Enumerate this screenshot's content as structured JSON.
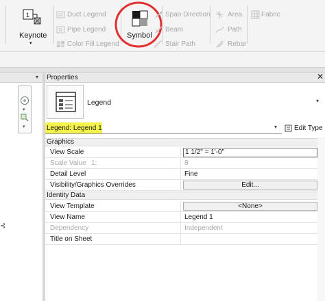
{
  "ribbon": {
    "keynote_label": "Keynote",
    "symbol_label": "Symbol",
    "items": [
      {
        "label": "Duct Legend",
        "icon": "duct-legend-icon"
      },
      {
        "label": "Pipe Legend",
        "icon": "pipe-legend-icon"
      },
      {
        "label": "Color Fill Legend",
        "icon": "color-fill-legend-icon"
      },
      {
        "label": "Span Direction",
        "icon": "span-direction-icon"
      },
      {
        "label": "Beam",
        "icon": "beam-icon"
      },
      {
        "label": "Stair Path",
        "icon": "stair-path-icon"
      },
      {
        "label": "Area",
        "icon": "area-icon"
      },
      {
        "label": "Path",
        "icon": "path-icon"
      },
      {
        "label": "Rebar",
        "icon": "rebar-icon"
      },
      {
        "label": "Fabric",
        "icon": "fabric-icon"
      }
    ],
    "highlight_color": "#e03030"
  },
  "properties": {
    "title": "Properties",
    "type_name": "Legend",
    "instance_selector": "Legend: Legend 1",
    "edit_type_label": "Edit Type",
    "highlight_color": "#f3f34c",
    "sections": {
      "graphics": "Graphics",
      "identity": "Identity Data"
    },
    "rows": {
      "view_scale": {
        "label": "View Scale",
        "value": "1 1/2\" = 1'-0\""
      },
      "scale_value": {
        "label": "Scale Value",
        "mid": "1:",
        "value": "8"
      },
      "detail_level": {
        "label": "Detail Level",
        "value": "Fine"
      },
      "vg_overrides": {
        "label": "Visibility/Graphics Overrides",
        "value": "Edit..."
      },
      "view_template": {
        "label": "View Template",
        "value": "<None>"
      },
      "view_name": {
        "label": "View Name",
        "value": "Legend 1"
      },
      "dependency": {
        "label": "Dependency",
        "value": "Independent"
      },
      "title_on_sheet": {
        "label": "Title on Sheet",
        "value": ""
      }
    }
  }
}
